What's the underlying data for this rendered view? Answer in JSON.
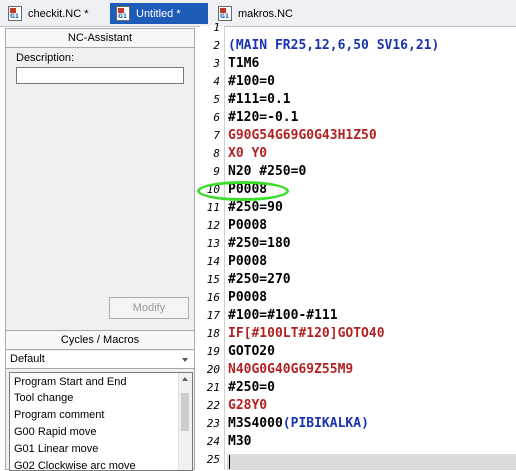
{
  "tabs": [
    {
      "label": "checkit.NC *"
    },
    {
      "label": "Untitled *"
    },
    {
      "label": "makros.NC"
    }
  ],
  "assistant": {
    "title": "NC-Assistant",
    "description_label": "Description:",
    "description_value": "",
    "modify_label": "Modify"
  },
  "cycles": {
    "title": "Cycles / Macros",
    "selected": "Default",
    "items": [
      "Program Start and End",
      "Tool change",
      "Program comment",
      "G00 Rapid move",
      "G01 Linear move",
      "G02 Clockwise arc move"
    ]
  },
  "editor": {
    "lines": [
      {
        "n": "1",
        "text": "",
        "color": "#000000"
      },
      {
        "n": "2",
        "text": "(MAIN FR25,12,6,50 SV16,21)",
        "color": "#1a34b0"
      },
      {
        "n": "3",
        "text": "T1M6",
        "color": "#000000"
      },
      {
        "n": "4",
        "text": "#100=0",
        "color": "#000000"
      },
      {
        "n": "5",
        "text": "#111=0.1",
        "color": "#000000"
      },
      {
        "n": "6",
        "text": "#120=-0.1",
        "color": "#000000"
      },
      {
        "n": "7",
        "text": "G90G54G69G0G43H1Z50",
        "color": "#b22222"
      },
      {
        "n": "8",
        "text": "X0 Y0",
        "color": "#b22222"
      },
      {
        "n": "9",
        "text": "N20 #250=0",
        "color": "#000000"
      },
      {
        "n": "10",
        "text": "P0008",
        "color": "#000000"
      },
      {
        "n": "11",
        "text": "#250=90",
        "color": "#000000"
      },
      {
        "n": "12",
        "text": "P0008",
        "color": "#000000"
      },
      {
        "n": "13",
        "text": "#250=180",
        "color": "#000000"
      },
      {
        "n": "14",
        "text": "P0008",
        "color": "#000000"
      },
      {
        "n": "15",
        "text": "#250=270",
        "color": "#000000"
      },
      {
        "n": "16",
        "text": "P0008",
        "color": "#000000"
      },
      {
        "n": "17",
        "text": "#100=#100-#111",
        "color": "#000000"
      },
      {
        "n": "18",
        "text": "IF[#100LT#120]GOTO40",
        "color": "#b22222"
      },
      {
        "n": "19",
        "text": "GOTO20",
        "color": "#000000"
      },
      {
        "n": "20",
        "text": "N40G0G40G69Z55M9",
        "color": "#b22222"
      },
      {
        "n": "21",
        "text": "#250=0",
        "color": "#000000"
      },
      {
        "n": "22",
        "text": "G28Y0",
        "color": "#b22222"
      },
      {
        "n": "23",
        "text": "M3S4000",
        "color": "#000000",
        "comment": "(PIBIKALKA)",
        "comment_color": "#1a34b0"
      },
      {
        "n": "24",
        "text": "M30",
        "color": "#000000"
      },
      {
        "n": "25",
        "text": "",
        "color": "#000000"
      }
    ]
  },
  "colors": {
    "active_tab": "#1d5bb8",
    "annotation_circle": "#3bdc2a"
  }
}
